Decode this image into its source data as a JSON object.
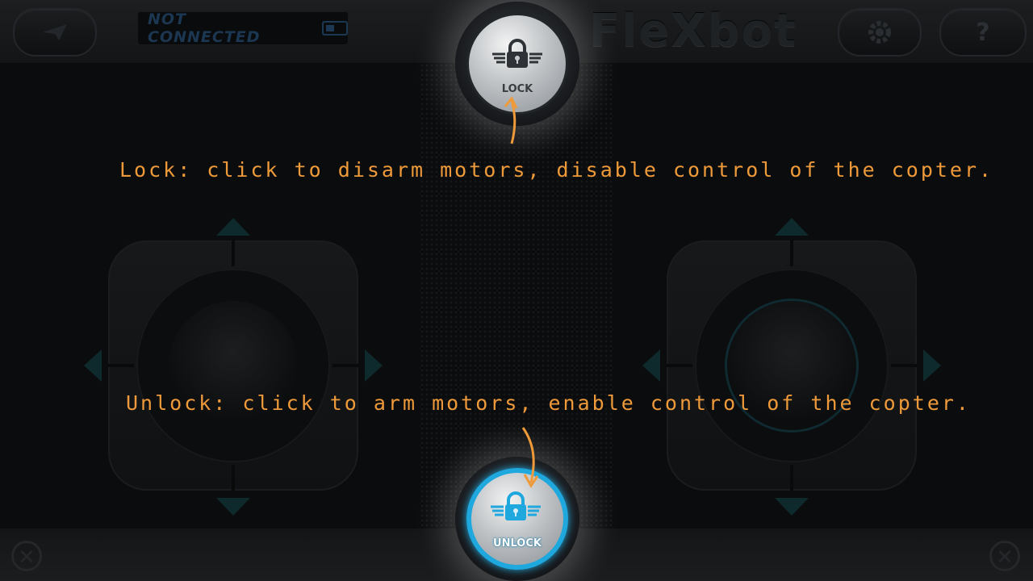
{
  "header": {
    "status": "NOT CONNECTED",
    "logo": "FleXbot",
    "settings_icon": "gear-icon",
    "help_label": "?",
    "send_icon": "paper-plane-icon"
  },
  "buttons": {
    "lock_label": "LOCK",
    "unlock_label": "UNLOCK"
  },
  "annotations": {
    "lock": "Lock: click to disarm motors, disable control of the copter.",
    "unlock": "Unlock: click to arm motors, enable control of the copter."
  },
  "colors": {
    "annotation": "#ee9a3a",
    "unlock_ring": "#1fa8dd"
  }
}
